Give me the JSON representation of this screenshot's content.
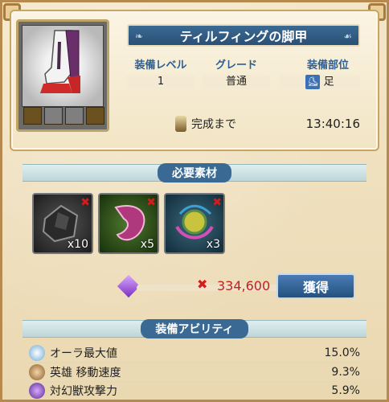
{
  "equipment": {
    "title": "ティルフィングの脚甲",
    "stats": [
      {
        "label": "装備レベル",
        "value": "1"
      },
      {
        "label": "グレード",
        "value": "普通"
      },
      {
        "label": "装備部位",
        "value": "足"
      }
    ],
    "timer_label": "完成まで",
    "timer_value": "13:40:16"
  },
  "materials": {
    "header": "必要素材",
    "items": [
      {
        "qty": "x10",
        "icon": "dark-ore-icon"
      },
      {
        "qty": "x5",
        "icon": "pink-fabric-icon"
      },
      {
        "qty": "x3",
        "icon": "rainbow-orb-icon"
      }
    ],
    "cost": "334,600",
    "get_label": "獲得"
  },
  "abilities": {
    "header": "装備アビリティ",
    "items": [
      {
        "name": "オーラ最大値",
        "value": "15.0%"
      },
      {
        "name": "英雄 移動速度",
        "value": "9.3%"
      },
      {
        "name": "対幻獣攻撃力",
        "value": "5.9%"
      }
    ]
  },
  "colors": {
    "accent": "#3a6a93",
    "cost": "#c42020"
  }
}
